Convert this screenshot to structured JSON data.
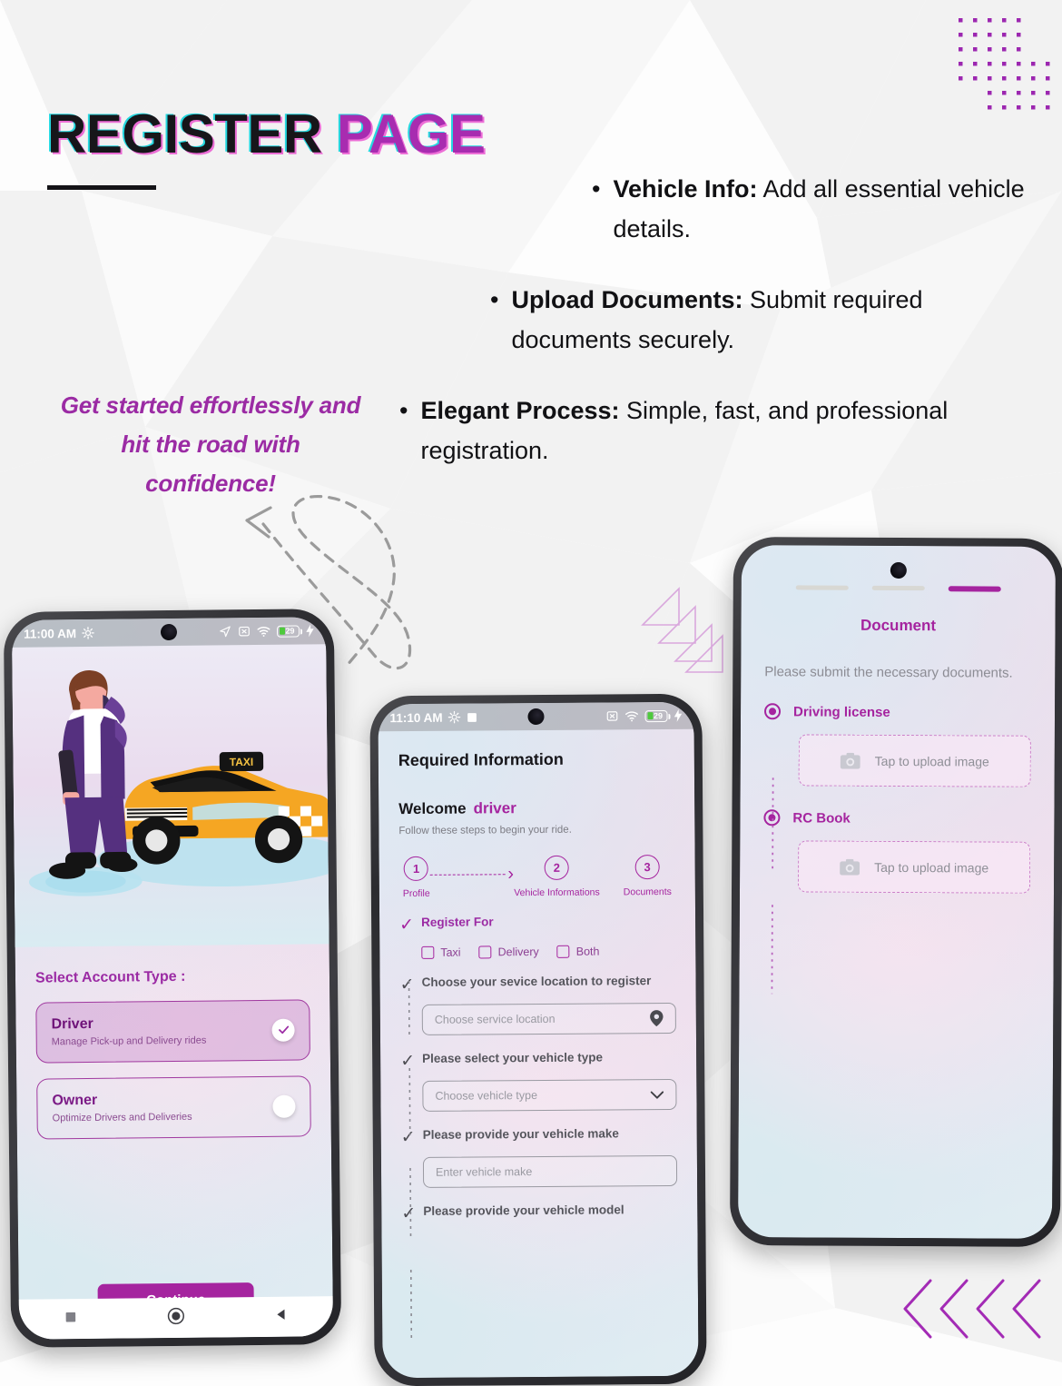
{
  "poster": {
    "title_part1": "REGISTER ",
    "title_part2": "PAGE",
    "tagline": "Get started effortlessly and hit the road with confidence!",
    "accent_purple": "#a5249f",
    "accent_dark": "#17161a",
    "bullets": [
      {
        "lead": "Vehicle Info:",
        "rest": " Add all essential vehicle details."
      },
      {
        "lead": "Upload Documents:",
        "rest": " Submit required documents securely."
      },
      {
        "lead": "Elegant Process:",
        "rest": " Simple, fast, and professional registration."
      }
    ]
  },
  "phone1": {
    "status": {
      "time": "11:00 AM",
      "battery_pct": "29",
      "icons": [
        "gear-icon",
        "navigation-icon",
        "no-sim-icon",
        "wifi-icon",
        "battery-icon",
        "charging-bolt-icon"
      ]
    },
    "section_label": "Select Account Type :",
    "options": [
      {
        "title": "Driver",
        "subtitle": "Manage Pick-up and Delivery rides",
        "selected": true,
        "check": "✓"
      },
      {
        "title": "Owner",
        "subtitle": "Optimize Drivers and Deliveries",
        "selected": false,
        "check": ""
      }
    ],
    "continue_label": "Continue",
    "nav_icons": [
      "recents-square-icon",
      "home-circle-icon",
      "back-triangle-icon"
    ]
  },
  "phone2": {
    "status": {
      "time": "11:10 AM",
      "battery_pct": "29",
      "icons": [
        "gear-icon",
        "stop-square-icon",
        "no-sim-icon",
        "wifi-icon",
        "battery-icon",
        "charging-bolt-icon"
      ]
    },
    "header": "Required Information",
    "welcome_label": "Welcome",
    "welcome_user": "driver",
    "subtitle": "Follow these steps to begin your ride.",
    "steps": [
      {
        "num": "1",
        "label": "Profile"
      },
      {
        "num": "2",
        "label": "Vehicle Informations"
      },
      {
        "num": "3",
        "label": "Documents"
      }
    ],
    "step_arrow": "›",
    "sections": [
      {
        "label": "Register For",
        "purple": true
      },
      {
        "label": "Choose your sevice location to register",
        "purple": false
      },
      {
        "label": "Please select your vehicle type",
        "purple": false
      },
      {
        "label": "Please provide your vehicle make",
        "purple": false
      },
      {
        "label": "Please provide your vehicle model",
        "purple": false
      }
    ],
    "checkboxes": [
      "Taxi",
      "Delivery",
      "Both"
    ],
    "fields": [
      {
        "placeholder": "Choose service location",
        "icon": "location-pin-icon"
      },
      {
        "placeholder": "Choose vehicle type",
        "icon": "chevron-down-icon"
      },
      {
        "placeholder": "Enter vehicle make",
        "icon": ""
      }
    ],
    "tick": "✓"
  },
  "phone3": {
    "title": "Document",
    "subtitle": "Please submit the necessary documents.",
    "progress": [
      {
        "active": false
      },
      {
        "active": false
      },
      {
        "active": true
      }
    ],
    "documents": [
      {
        "label": "Driving license",
        "upload_text": "Tap to upload image",
        "icon": "camera-icon"
      },
      {
        "label": "RC Book",
        "upload_text": "Tap to upload image",
        "icon": "camera-icon"
      }
    ]
  }
}
